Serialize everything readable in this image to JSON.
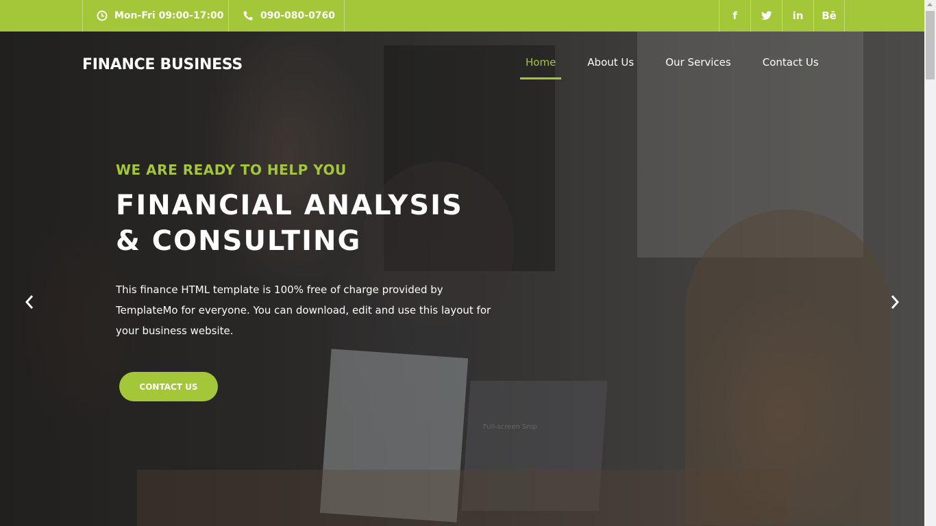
{
  "topbar": {
    "hours": "Mon-Fri 09:00-17:00",
    "phone": "090-080-0760",
    "social": [
      "f",
      "t",
      "in",
      "Bē"
    ]
  },
  "header": {
    "brand": "FINANCE BUSINESS",
    "nav": [
      {
        "label": "Home",
        "active": true
      },
      {
        "label": "About Us"
      },
      {
        "label": "Our Services"
      },
      {
        "label": "Contact Us"
      }
    ]
  },
  "hero": {
    "tagline": "WE ARE READY TO HELP YOU",
    "headline_line1": "FINANCIAL ANALYSIS",
    "headline_line2": "& CONSULTING",
    "description": "This finance HTML template is 100% free of charge provided by TemplateMo for everyone. You can download, edit and use this layout for your business website.",
    "cta": "CONTACT US",
    "faint_text": "Full-screen Snip"
  },
  "colors": {
    "accent": "#a4c639",
    "text_light": "#ffffff"
  },
  "icons": {
    "hours": "clock-icon",
    "phone": "phone-icon",
    "prev": "chevron-left-icon",
    "next": "chevron-right-icon"
  }
}
